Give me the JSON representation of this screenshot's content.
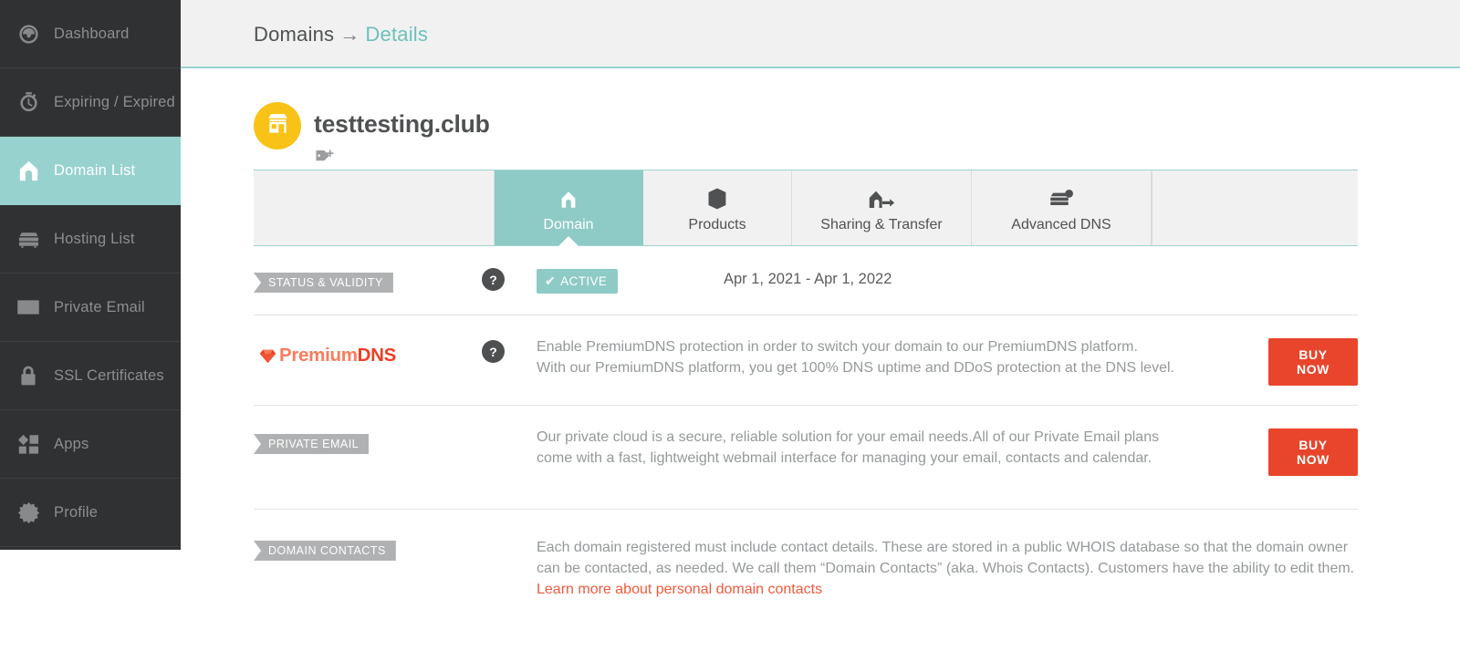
{
  "sidebar": {
    "items": [
      {
        "label": "Dashboard",
        "icon": "gauge-icon",
        "active": false
      },
      {
        "label": "Expiring / Expired",
        "icon": "stopwatch-icon",
        "active": false
      },
      {
        "label": "Domain List",
        "icon": "house-icon",
        "active": true
      },
      {
        "label": "Hosting List",
        "icon": "server-icon",
        "active": false
      },
      {
        "label": "Private Email",
        "icon": "envelope-icon",
        "active": false
      },
      {
        "label": "SSL Certificates",
        "icon": "lock-icon",
        "active": false
      },
      {
        "label": "Apps",
        "icon": "apps-icon",
        "active": false
      },
      {
        "label": "Profile",
        "icon": "gear-icon",
        "active": false
      }
    ]
  },
  "breadcrumb": {
    "root": "Domains",
    "separator": "→",
    "current": "Details"
  },
  "domain": {
    "name": "testtesting.club",
    "avatar_icon": "shop-icon",
    "avatar_color": "#f8c316",
    "tag_icon": "tag-plus-icon"
  },
  "tabs": [
    {
      "label": "Domain",
      "icon": "house-icon",
      "active": true
    },
    {
      "label": "Products",
      "icon": "box-icon",
      "active": false
    },
    {
      "label": "Sharing & Transfer",
      "icon": "house-arrow-icon",
      "active": false
    },
    {
      "label": "Advanced DNS",
      "icon": "server-gear-icon",
      "active": false
    }
  ],
  "sections": {
    "status": {
      "label": "STATUS & VALIDITY",
      "help": "?",
      "badge": "ACTIVE",
      "badge_check": "✔",
      "badge_color": "#8ecac6",
      "dates": "Apr 1, 2021 - Apr 1, 2022"
    },
    "premium_dns": {
      "logo_prefix": "Premium",
      "logo_suffix": "DNS",
      "logo_icon": "diamond-icon",
      "help": "?",
      "desc_line_1": "Enable PremiumDNS protection in order to switch your domain to our PremiumDNS platform.",
      "desc_line_2": "With our PremiumDNS platform, you get 100% DNS uptime and DDoS protection at the DNS level.",
      "buy_label": "BUY NOW"
    },
    "private_email": {
      "label": "PRIVATE EMAIL",
      "desc_line_1": "Our private cloud is a secure, reliable solution for your email needs.All of our Private Email plans",
      "desc_line_2": "come with a fast, lightweight webmail interface for managing your email, contacts and calendar.",
      "buy_label": "BUY NOW"
    },
    "domain_contacts": {
      "label": "DOMAIN CONTACTS",
      "desc_line_1": "Each domain registered must include contact details. These are stored in a public WHOIS database so that the domain owner",
      "desc_line_2": "can be contacted, as needed. We call them “Domain Contacts” (aka. Whois Contacts). Customers have the ability to edit them.",
      "link": "Learn more about personal domain contacts"
    }
  },
  "theme": {
    "accent_teal": "#8ecac6",
    "sidebar_bg": "#2f3132",
    "danger_red": "#e8452c",
    "link_red": "#ef5a3e",
    "label_gray": "#b0b1b2"
  }
}
